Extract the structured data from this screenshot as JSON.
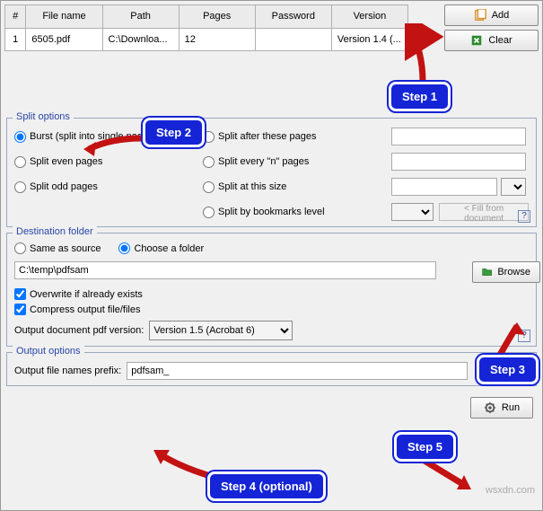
{
  "table": {
    "headers": [
      "#",
      "File name",
      "Path",
      "Pages",
      "Password",
      "Version"
    ],
    "row": {
      "num": "1",
      "filename": "6505.pdf",
      "path": "C:\\Downloa...",
      "pages": "12",
      "password": "",
      "version": "Version 1.4 (..."
    }
  },
  "buttons": {
    "add": "Add",
    "clear": "Clear",
    "browse": "Browse",
    "run": "Run",
    "fill_doc": "< Fill from document"
  },
  "split": {
    "legend": "Split options",
    "burst": "Burst (split into single pages)",
    "even": "Split even pages",
    "odd": "Split odd pages",
    "after": "Split after these pages",
    "every": "Split every \"n\" pages",
    "size": "Split at this size",
    "bookmarks": "Split by bookmarks level"
  },
  "dest": {
    "legend": "Destination folder",
    "same": "Same as source",
    "choose": "Choose a folder",
    "path": "C:\\temp\\pdfsam",
    "overwrite": "Overwrite if already exists",
    "compress": "Compress output file/files",
    "version_label": "Output document pdf version:",
    "version_value": "Version 1.5 (Acrobat 6)"
  },
  "output": {
    "legend": "Output options",
    "prefix_label": "Output file names prefix:",
    "prefix_value": "pdfsam_"
  },
  "callouts": {
    "s1": "Step 1",
    "s2": "Step 2",
    "s3": "Step 3",
    "s4": "Step 4 (optional)",
    "s5": "Step 5"
  },
  "watermark": "wsxdn.com"
}
